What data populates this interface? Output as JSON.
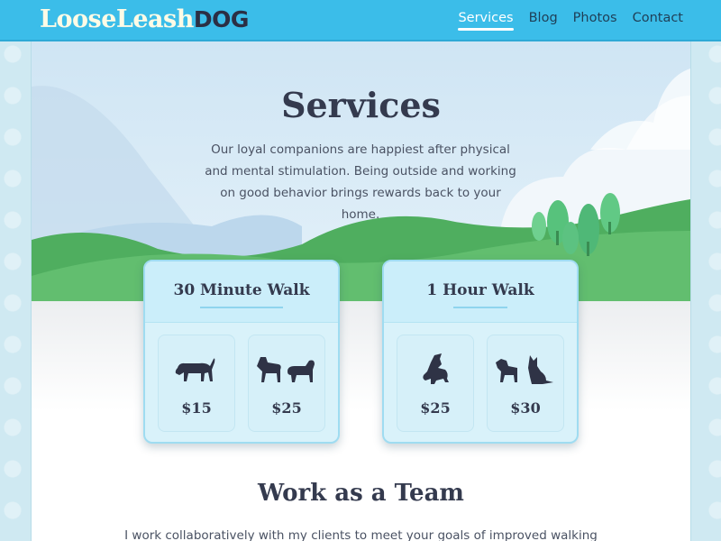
{
  "brand": {
    "name_part1": "LooseLeash",
    "name_part2": "DOG"
  },
  "nav": {
    "items": [
      {
        "label": "Services",
        "active": true
      },
      {
        "label": "Blog",
        "active": false
      },
      {
        "label": "Photos",
        "active": false
      },
      {
        "label": "Contact",
        "active": false
      }
    ]
  },
  "hero": {
    "title": "Services",
    "description": "Our loyal companions are happiest after physical and mental stimulation. Being outside and working on good behavior brings rewards back to your home."
  },
  "services": [
    {
      "title": "30 Minute Walk",
      "options": [
        {
          "icon": "single-dog-icon",
          "price": "$15"
        },
        {
          "icon": "two-dogs-icon",
          "price": "$25"
        }
      ]
    },
    {
      "title": "1 Hour Walk",
      "options": [
        {
          "icon": "howling-dog-icon",
          "price": "$25"
        },
        {
          "icon": "two-dogs-sitting-icon",
          "price": "$30"
        }
      ]
    }
  ],
  "team": {
    "title": "Work as a Team",
    "text": "I work collaboratively with my clients to meet your goals of improved walking"
  },
  "colors": {
    "header": "#3bbde9",
    "sky": "#d6ecf8",
    "hills": "#58b96a",
    "card": "#d9f2fa",
    "text_dark": "#343a4e"
  }
}
